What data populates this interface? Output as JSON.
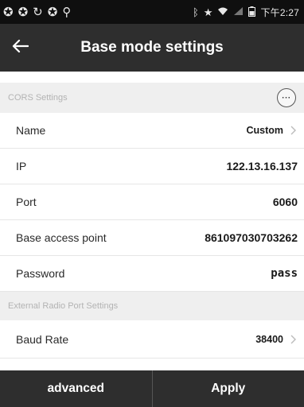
{
  "status_bar": {
    "left_icons": [
      "notification-icon",
      "notification-icon",
      "sync-icon",
      "notification-icon",
      "location-pin-icon"
    ],
    "right_icons": [
      "bluetooth-icon",
      "star-icon",
      "wifi-icon",
      "signal-icon",
      "battery-icon"
    ],
    "time": "下午2:27"
  },
  "header": {
    "back_icon": "arrow-left-icon",
    "title": "Base mode settings"
  },
  "cors_section": {
    "title": "CORS Settings",
    "more_label": "···"
  },
  "cors_rows": [
    {
      "label": "Name",
      "value": "Custom",
      "has_chevron": true
    },
    {
      "label": "IP",
      "value": "122.13.16.137",
      "has_chevron": false
    },
    {
      "label": "Port",
      "value": "6060",
      "has_chevron": false
    },
    {
      "label": "Base access point",
      "value": "861097030703262",
      "has_chevron": false
    },
    {
      "label": "Password",
      "value": "pass",
      "has_chevron": false
    }
  ],
  "radio_section": {
    "title": "External Radio Port Settings"
  },
  "radio_rows": [
    {
      "label": "Baud Rate",
      "value": "38400",
      "has_chevron": true
    }
  ],
  "footer": {
    "advanced_label": "advanced",
    "apply_label": "Apply"
  },
  "colors": {
    "bar_background": "#2e2e2e",
    "status_background": "#0f0f0f",
    "section_background": "#efefef",
    "section_text": "#b3b3b3"
  }
}
